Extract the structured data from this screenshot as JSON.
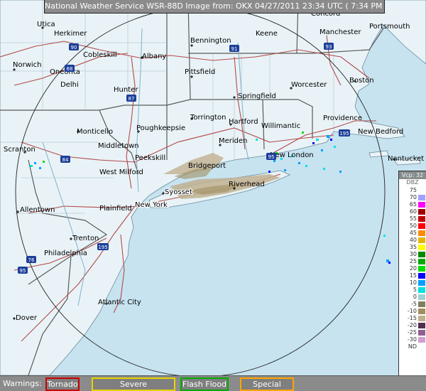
{
  "header": {
    "title": "National Weather Service WSR-88D Image from: OKX 04/27/2011 23:34 UTC ( 7:34 PM EDT)"
  },
  "legend": {
    "title": "Vcp: 32",
    "unit": "DBZ",
    "rows": [
      {
        "value": "75",
        "color": "#ffffff"
      },
      {
        "value": "70",
        "color": "#a0a0ff"
      },
      {
        "value": "65",
        "color": "#ff00ff"
      },
      {
        "value": "60",
        "color": "#a00000"
      },
      {
        "value": "55",
        "color": "#c00000"
      },
      {
        "value": "50",
        "color": "#ff0000"
      },
      {
        "value": "45",
        "color": "#ff8c00"
      },
      {
        "value": "40",
        "color": "#e6b400"
      },
      {
        "value": "35",
        "color": "#ffff00"
      },
      {
        "value": "30",
        "color": "#008800"
      },
      {
        "value": "25",
        "color": "#00aa00"
      },
      {
        "value": "20",
        "color": "#00dd00"
      },
      {
        "value": "15",
        "color": "#0000ff"
      },
      {
        "value": "10",
        "color": "#00a0ff"
      },
      {
        "value": "5",
        "color": "#00e0e0"
      },
      {
        "value": "0",
        "color": "#a0d0d0"
      },
      {
        "value": "-5",
        "color": "#808060"
      },
      {
        "value": "-10",
        "color": "#a09060"
      },
      {
        "value": "-15",
        "color": "#c0b090"
      },
      {
        "value": "-20",
        "color": "#503050"
      },
      {
        "value": "-25",
        "color": "#906090"
      },
      {
        "value": "-30",
        "color": "#d0a0d0"
      },
      {
        "value": "ND",
        "color": "#ffffff"
      }
    ]
  },
  "warnings": {
    "label": "Warnings:",
    "buttons": [
      {
        "label": "Tornado",
        "border": "#cc0000"
      },
      {
        "label": "Severe Thunderstorm",
        "border": "#e6d300"
      },
      {
        "label": "Flash Flood",
        "border": "#00aa00"
      },
      {
        "label": "Special Marine",
        "border": "#ffa500"
      }
    ]
  },
  "map": {
    "cities": [
      {
        "name": "Utica"
      },
      {
        "name": "Herkimer"
      },
      {
        "name": "Norwich"
      },
      {
        "name": "Cobleskill"
      },
      {
        "name": "Albany"
      },
      {
        "name": "Oneonta"
      },
      {
        "name": "Delhi"
      },
      {
        "name": "Hunter"
      },
      {
        "name": "Bennington"
      },
      {
        "name": "Keene"
      },
      {
        "name": "Concord"
      },
      {
        "name": "Manchester"
      },
      {
        "name": "Portsmouth"
      },
      {
        "name": "Pittsfield"
      },
      {
        "name": "Worcester"
      },
      {
        "name": "Boston"
      },
      {
        "name": "Springfield"
      },
      {
        "name": "Torrington"
      },
      {
        "name": "Hartford"
      },
      {
        "name": "Willimantic"
      },
      {
        "name": "Providence"
      },
      {
        "name": "New Bedford"
      },
      {
        "name": "Nantucket"
      },
      {
        "name": "Monticello"
      },
      {
        "name": "Poughkeepsie"
      },
      {
        "name": "Middletown"
      },
      {
        "name": "Peekskill"
      },
      {
        "name": "Meriden"
      },
      {
        "name": "New London"
      },
      {
        "name": "Bridgeport"
      },
      {
        "name": "Scranton"
      },
      {
        "name": "West Milford"
      },
      {
        "name": "Riverhead"
      },
      {
        "name": "Syosset"
      },
      {
        "name": "Allentown"
      },
      {
        "name": "Plainfield"
      },
      {
        "name": "New York"
      },
      {
        "name": "Trenton"
      },
      {
        "name": "Philadelphia"
      },
      {
        "name": "Atlantic City"
      },
      {
        "name": "Dover"
      }
    ],
    "interstates": [
      {
        "number": "90"
      },
      {
        "number": "88"
      },
      {
        "number": "91"
      },
      {
        "number": "93"
      },
      {
        "number": "87"
      },
      {
        "number": "84"
      },
      {
        "number": "95"
      },
      {
        "number": "195"
      },
      {
        "number": "195"
      },
      {
        "number": "76"
      },
      {
        "number": "95"
      }
    ]
  }
}
